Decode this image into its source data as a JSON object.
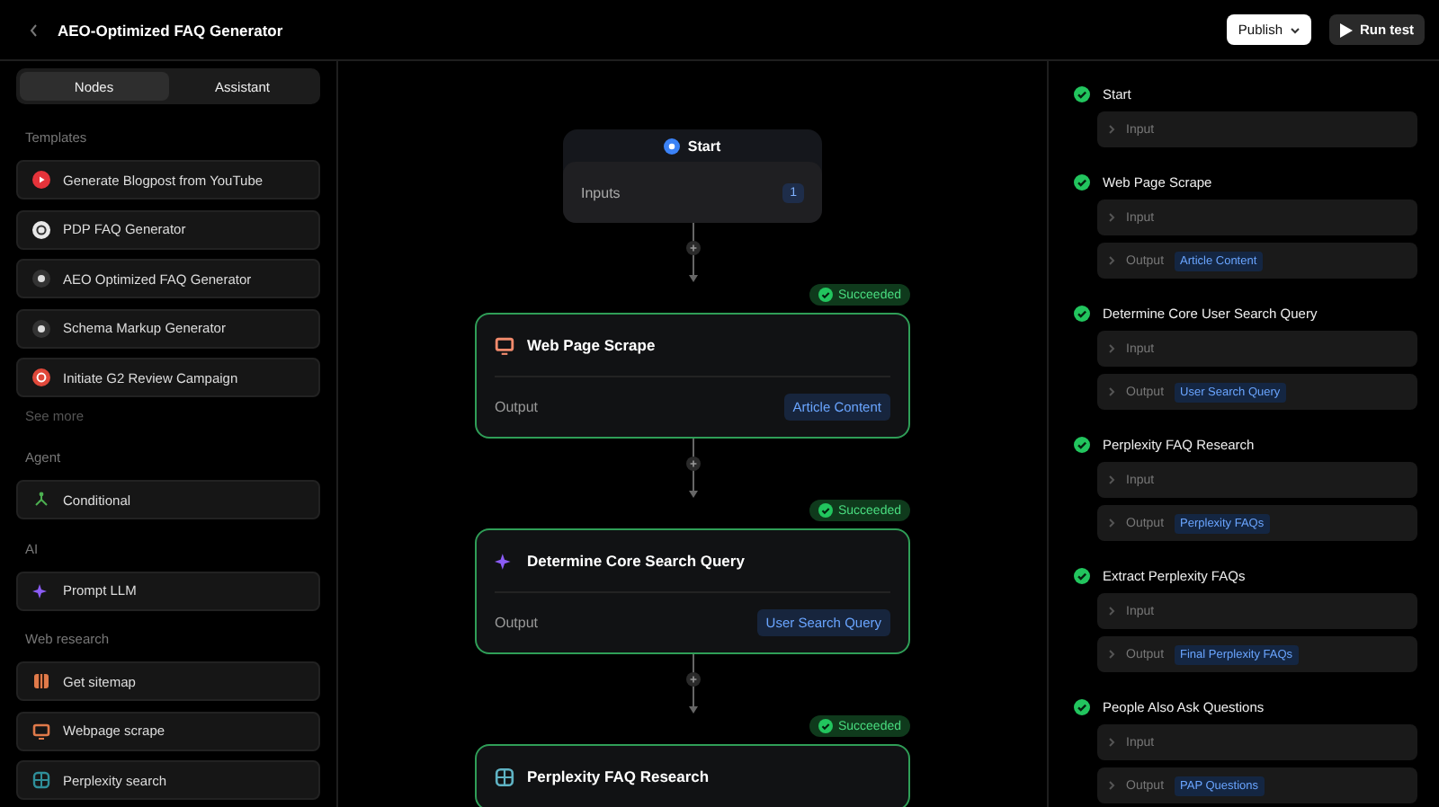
{
  "header": {
    "title": "AEO-Optimized FAQ Generator",
    "publish": "Publish",
    "run_test": "Run test"
  },
  "sidebar": {
    "tabs": [
      {
        "label": "Nodes",
        "selected": true
      },
      {
        "label": "Assistant",
        "selected": false
      }
    ],
    "sections": [
      {
        "heading": "Templates",
        "items": [
          {
            "label": "Generate Blogpost from YouTube",
            "color": "#e5333a"
          },
          {
            "label": "PDP FAQ Generator",
            "color": "#e8e8e8"
          },
          {
            "label": "AEO Optimized FAQ Generator",
            "color": "#333333"
          },
          {
            "label": "Schema Markup Generator",
            "color": "#333333"
          },
          {
            "label": "Initiate G2 Review Campaign",
            "color": "#e0483a"
          }
        ],
        "see_more": "See more"
      },
      {
        "heading": "Agent",
        "items": [
          {
            "label": "Conditional",
            "color": "#4caf50"
          }
        ]
      },
      {
        "heading": "AI",
        "items": [
          {
            "label": "Prompt LLM",
            "color": "#8b5cf6"
          }
        ]
      },
      {
        "heading": "Web research",
        "items": [
          {
            "label": "Get sitemap",
            "color": "#e07a4a"
          },
          {
            "label": "Webpage scrape",
            "color": "#e07a4a"
          },
          {
            "label": "Perplexity search",
            "color": "#2f8f9a"
          }
        ]
      }
    ]
  },
  "canvas": {
    "start": {
      "title": "Start",
      "inputs_label": "Inputs",
      "inputs_count": "1"
    },
    "nodes": [
      {
        "title": "Web Page Scrape",
        "status": "Succeeded",
        "output_label": "Output",
        "output_value": "Article Content"
      },
      {
        "title": "Determine Core Search Query",
        "status": "Succeeded",
        "output_label": "Output",
        "output_value": "User Search Query"
      },
      {
        "title": "Perplexity FAQ Research",
        "status": "Succeeded"
      }
    ]
  },
  "run_panel": {
    "steps": [
      {
        "title": "Start",
        "done": true,
        "rows": [
          {
            "label": "Input"
          }
        ]
      },
      {
        "title": "Web Page Scrape",
        "done": true,
        "rows": [
          {
            "label": "Input"
          },
          {
            "label": "Output",
            "value": "Article Content"
          }
        ]
      },
      {
        "title": "Determine Core User Search Query",
        "done": true,
        "rows": [
          {
            "label": "Input"
          },
          {
            "label": "Output",
            "value": "User Search Query"
          }
        ]
      },
      {
        "title": "Perplexity FAQ Research",
        "done": true,
        "rows": [
          {
            "label": "Input"
          },
          {
            "label": "Output",
            "value": "Perplexity FAQs"
          }
        ]
      },
      {
        "title": "Extract Perplexity FAQs",
        "done": true,
        "rows": [
          {
            "label": "Input"
          },
          {
            "label": "Output",
            "value": "Final Perplexity FAQs"
          }
        ]
      },
      {
        "title": "People Also Ask Questions",
        "done": true,
        "rows": [
          {
            "label": "Input"
          },
          {
            "label": "Output",
            "value": "PAP Questions"
          }
        ]
      }
    ]
  }
}
